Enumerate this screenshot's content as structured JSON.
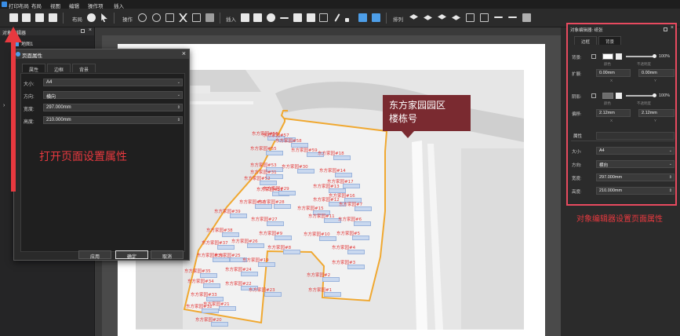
{
  "menu": {
    "app_title": "打印布局",
    "items": [
      "布局",
      "视图",
      "编辑",
      "操作项",
      "插入"
    ]
  },
  "toolbar": {
    "group_layout": "布局",
    "group_ops": "操作",
    "group_insert": "插入",
    "group_arrange": "排列"
  },
  "left_panel": {
    "title": "对象编辑器",
    "layer_item": "地图1"
  },
  "dialog": {
    "title": "页面属性",
    "tabs": [
      "属性",
      "边框",
      "背景"
    ],
    "size_label": "大小:",
    "size_value": "A4",
    "orient_label": "方向:",
    "orient_value": "横向",
    "width_label": "宽度:",
    "width_value": "297.000mm",
    "height_label": "高度:",
    "height_value": "210.000mm",
    "btn_apply": "应用",
    "btn_ok": "确定",
    "btn_cancel": "取消"
  },
  "annotations": {
    "open_page_props": "打开页面设置属性",
    "right_caption": "对象编辑器设置页面属性"
  },
  "callout": {
    "line1": "东方家园园区",
    "line2": "楼栋号"
  },
  "right_panel": {
    "title": "对象编辑器: 纸张",
    "tabs": [
      "边框",
      "背景"
    ],
    "bg_label": "背景:",
    "opacity1": "100%",
    "color_sub": "颜色",
    "opacity_sub": "不透明度",
    "expand_label": "扩展:",
    "expand_x": "0.00mm",
    "expand_y": "0.00mm",
    "x_sub": "X",
    "y_sub": "Y",
    "shadow_label": "阴影:",
    "opacity2": "100%",
    "offset_label": "偏移:",
    "offset_x": "2.12mm",
    "offset_y": "2.12mm",
    "props_header": "属性",
    "size_label": "大小:",
    "size_value": "A4",
    "orient_label": "方向:",
    "orient_value": "横向",
    "width_label": "宽度:",
    "width_value": "297.000mm",
    "height_label": "高度:",
    "height_value": "210.000mm"
  },
  "buildings": [
    "东方家园#1",
    "东方家园#2",
    "东方家园#3",
    "东方家园#4",
    "东方家园#5",
    "东方家园#6",
    "东方家园#7",
    "东方家园#8",
    "东方家园#9",
    "东方家园#10",
    "东方家园#11",
    "东方家园#12",
    "东方家园#13",
    "东方家园#14",
    "东方家园#15",
    "东方家园#16",
    "东方家园#17",
    "东方家园#18",
    "东方家园#19",
    "东方家园#20",
    "东方家园#21",
    "东方家园#22",
    "东方家园#23",
    "东方家园#24",
    "东方家园#25",
    "东方家园#26",
    "东方家园#27",
    "东方家园#28",
    "东方家园#29",
    "东方家园#30",
    "东方家园#31",
    "东方家园#32",
    "东方家园#33",
    "东方家园#34",
    "东方家园#35",
    "东方家园#36",
    "东方家园#37",
    "东方家园#38",
    "东方家园#39",
    "东方家园#50",
    "东方家园#51",
    "东方家园#52",
    "东方家园#53",
    "东方家园#55",
    "东方家园#56",
    "东方家园#57",
    "东方家园#58",
    "东方家园#59"
  ],
  "colors": {
    "accent_red": "#e8393f",
    "callout_bg": "#7a2a30",
    "boundary": "#f0a830"
  }
}
